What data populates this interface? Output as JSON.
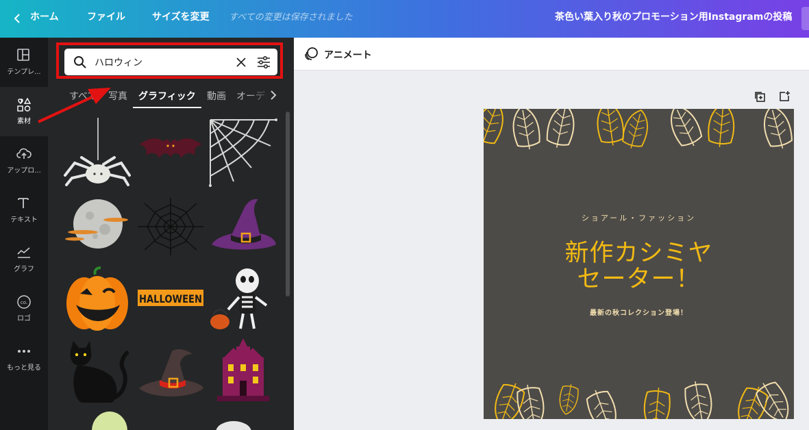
{
  "topbar": {
    "home": "ホーム",
    "file": "ファイル",
    "resize": "サイズを変更",
    "saved": "すべての変更は保存されました",
    "doc_title": "茶色い葉入り秋のプロモーション用Instagramの投稿"
  },
  "sidebar": {
    "items": [
      {
        "label": "テンプレ...",
        "icon": "template-icon"
      },
      {
        "label": "素材",
        "icon": "elements-icon"
      },
      {
        "label": "アップロ...",
        "icon": "upload-icon"
      },
      {
        "label": "テキスト",
        "icon": "text-icon"
      },
      {
        "label": "グラフ",
        "icon": "chart-icon"
      },
      {
        "label": "ロゴ",
        "icon": "logo-icon"
      },
      {
        "label": "もっと見る",
        "icon": "more-icon"
      }
    ]
  },
  "search": {
    "value": "ハロウィン"
  },
  "tabs": [
    "すべて",
    "写真",
    "グラフィック",
    "動画",
    "オーデ"
  ],
  "graphics": [
    {
      "name": "spider"
    },
    {
      "name": "bat"
    },
    {
      "name": "spider-web-corner"
    },
    {
      "name": "full-moon"
    },
    {
      "name": "spider-web"
    },
    {
      "name": "witch-hat-purple"
    },
    {
      "name": "jack-o-lantern"
    },
    {
      "name": "halloween-label",
      "text": "HALLOWEEN"
    },
    {
      "name": "skeleton"
    },
    {
      "name": "black-cat"
    },
    {
      "name": "witch-hat-dark"
    },
    {
      "name": "haunted-house"
    },
    {
      "name": "ghost-green"
    },
    {
      "name": "ghost-white"
    }
  ],
  "canvas": {
    "animate_label": "アニメート"
  },
  "design": {
    "small_title": "ショアール・ファッション",
    "headline_line1": "新作カシミヤ",
    "headline_line2": "セーター！",
    "subtitle": "最新の秋コレクション登場！"
  },
  "colors": {
    "highlight": "#e31212",
    "accent_gold": "#f2ba13",
    "cream": "#f3dfae",
    "design_bg": "#4d4b48"
  }
}
